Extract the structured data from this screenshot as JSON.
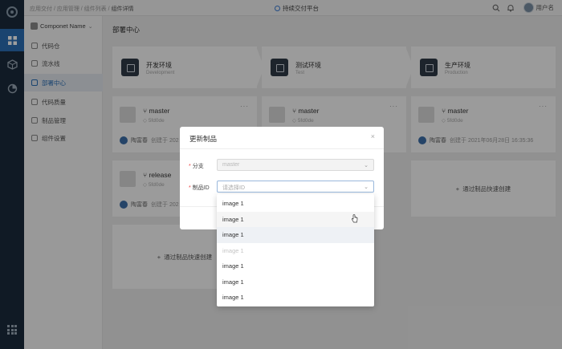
{
  "topbar": {
    "breadcrumb_path": "应用交付 / 应用管理 / 组件列表 /",
    "breadcrumb_current": "组件详情",
    "platform": "持续交付平台",
    "user": "用户名"
  },
  "sidebar": {
    "component": "Componet  Name",
    "items": [
      {
        "label": "代码仓"
      },
      {
        "label": "流水线"
      },
      {
        "label": "部署中心"
      },
      {
        "label": "代码质量"
      },
      {
        "label": "制品管理"
      },
      {
        "label": "组件设置"
      }
    ]
  },
  "main": {
    "title": "部署中心",
    "envs": [
      {
        "name": "开发环境",
        "sub": "Development"
      },
      {
        "name": "测试环境",
        "sub": "Test"
      },
      {
        "name": "生产环境",
        "sub": "Production"
      }
    ],
    "cards": [
      {
        "branch": "master",
        "hash": "5fd0de",
        "author": "陶富春",
        "action": "创建于 202"
      },
      {
        "branch": "master",
        "hash": "5fd0de",
        "author": "",
        "action": ""
      },
      {
        "branch": "master",
        "hash": "5fd0de",
        "author": "陶富春",
        "action": "创建于 2021年06月28日 16:35:36"
      },
      {
        "branch": "release",
        "hash": "5fd0de",
        "author": "陶富春",
        "action": "创建于 202"
      }
    ],
    "quick_create": "通过制品快速创建",
    "more": "···"
  },
  "modal": {
    "title": "更新制品",
    "close": "×",
    "branch_label": "分支",
    "branch_value": "master",
    "artifact_label": "制品ID",
    "artifact_placeholder": "请选择ID",
    "required_mark": "*"
  },
  "dropdown": {
    "options": [
      {
        "label": "image 1",
        "state": "normal"
      },
      {
        "label": "image 1",
        "state": "hover"
      },
      {
        "label": "image 1",
        "state": "selected"
      },
      {
        "label": "image 1",
        "state": "disabled"
      },
      {
        "label": "image 1",
        "state": "normal"
      },
      {
        "label": "image 1",
        "state": "normal"
      },
      {
        "label": "image 1",
        "state": "normal"
      }
    ]
  },
  "colors": {
    "rail": "#1b2b3c",
    "accent": "#2a6fb5",
    "required": "#e44444"
  }
}
